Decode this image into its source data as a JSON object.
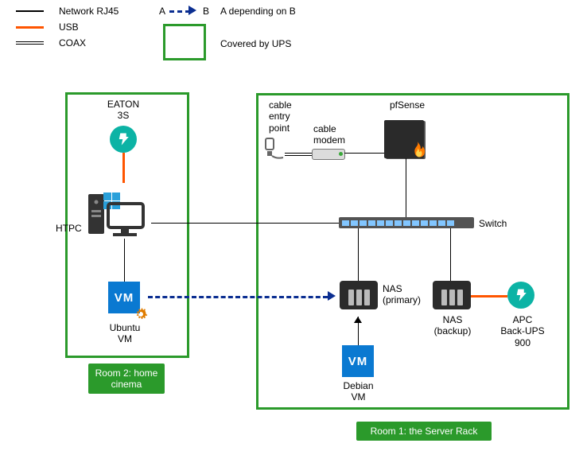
{
  "legend": {
    "network": "Network RJ45",
    "usb": "USB",
    "coax": "COAX",
    "depends_a": "A",
    "depends_b": "B",
    "depends_text": "A depending on B",
    "ups_text": "Covered by UPS"
  },
  "room1": {
    "banner": "Room 1: the Server Rack",
    "cable_entry": "cable\nentry\npoint",
    "cable_modem": "cable\nmodem",
    "pfsense": "pfSense",
    "switch": "Switch",
    "nas_primary": "NAS\n(primary)",
    "nas_backup": "NAS\n(backup)",
    "apc": "APC\nBack-UPS\n900",
    "debian": "Debian\nVM"
  },
  "room2": {
    "banner": "Room 2: home\ncinema",
    "eaton": "EATON\n3S",
    "htpc": "HTPC",
    "ubuntu": "Ubuntu\nVM"
  }
}
